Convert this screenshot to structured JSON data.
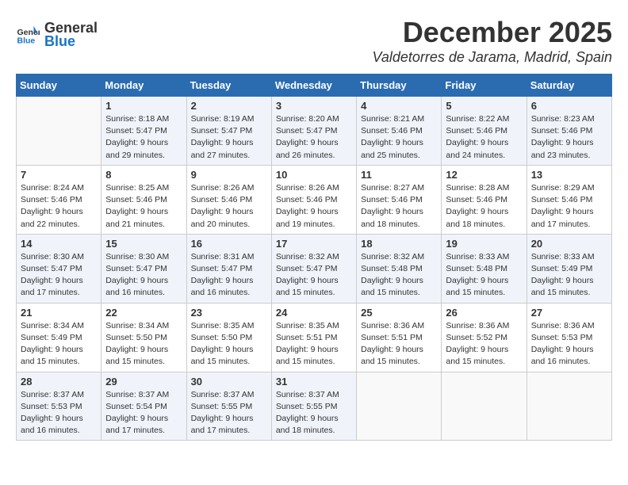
{
  "header": {
    "logo_line1": "General",
    "logo_line2": "Blue",
    "month": "December 2025",
    "location": "Valdetorres de Jarama, Madrid, Spain"
  },
  "weekdays": [
    "Sunday",
    "Monday",
    "Tuesday",
    "Wednesday",
    "Thursday",
    "Friday",
    "Saturday"
  ],
  "weeks": [
    [
      {
        "day": "",
        "info": ""
      },
      {
        "day": "1",
        "info": "Sunrise: 8:18 AM\nSunset: 5:47 PM\nDaylight: 9 hours\nand 29 minutes."
      },
      {
        "day": "2",
        "info": "Sunrise: 8:19 AM\nSunset: 5:47 PM\nDaylight: 9 hours\nand 27 minutes."
      },
      {
        "day": "3",
        "info": "Sunrise: 8:20 AM\nSunset: 5:47 PM\nDaylight: 9 hours\nand 26 minutes."
      },
      {
        "day": "4",
        "info": "Sunrise: 8:21 AM\nSunset: 5:46 PM\nDaylight: 9 hours\nand 25 minutes."
      },
      {
        "day": "5",
        "info": "Sunrise: 8:22 AM\nSunset: 5:46 PM\nDaylight: 9 hours\nand 24 minutes."
      },
      {
        "day": "6",
        "info": "Sunrise: 8:23 AM\nSunset: 5:46 PM\nDaylight: 9 hours\nand 23 minutes."
      }
    ],
    [
      {
        "day": "7",
        "info": "Sunrise: 8:24 AM\nSunset: 5:46 PM\nDaylight: 9 hours\nand 22 minutes."
      },
      {
        "day": "8",
        "info": "Sunrise: 8:25 AM\nSunset: 5:46 PM\nDaylight: 9 hours\nand 21 minutes."
      },
      {
        "day": "9",
        "info": "Sunrise: 8:26 AM\nSunset: 5:46 PM\nDaylight: 9 hours\nand 20 minutes."
      },
      {
        "day": "10",
        "info": "Sunrise: 8:26 AM\nSunset: 5:46 PM\nDaylight: 9 hours\nand 19 minutes."
      },
      {
        "day": "11",
        "info": "Sunrise: 8:27 AM\nSunset: 5:46 PM\nDaylight: 9 hours\nand 18 minutes."
      },
      {
        "day": "12",
        "info": "Sunrise: 8:28 AM\nSunset: 5:46 PM\nDaylight: 9 hours\nand 18 minutes."
      },
      {
        "day": "13",
        "info": "Sunrise: 8:29 AM\nSunset: 5:46 PM\nDaylight: 9 hours\nand 17 minutes."
      }
    ],
    [
      {
        "day": "14",
        "info": "Sunrise: 8:30 AM\nSunset: 5:47 PM\nDaylight: 9 hours\nand 17 minutes."
      },
      {
        "day": "15",
        "info": "Sunrise: 8:30 AM\nSunset: 5:47 PM\nDaylight: 9 hours\nand 16 minutes."
      },
      {
        "day": "16",
        "info": "Sunrise: 8:31 AM\nSunset: 5:47 PM\nDaylight: 9 hours\nand 16 minutes."
      },
      {
        "day": "17",
        "info": "Sunrise: 8:32 AM\nSunset: 5:47 PM\nDaylight: 9 hours\nand 15 minutes."
      },
      {
        "day": "18",
        "info": "Sunrise: 8:32 AM\nSunset: 5:48 PM\nDaylight: 9 hours\nand 15 minutes."
      },
      {
        "day": "19",
        "info": "Sunrise: 8:33 AM\nSunset: 5:48 PM\nDaylight: 9 hours\nand 15 minutes."
      },
      {
        "day": "20",
        "info": "Sunrise: 8:33 AM\nSunset: 5:49 PM\nDaylight: 9 hours\nand 15 minutes."
      }
    ],
    [
      {
        "day": "21",
        "info": "Sunrise: 8:34 AM\nSunset: 5:49 PM\nDaylight: 9 hours\nand 15 minutes."
      },
      {
        "day": "22",
        "info": "Sunrise: 8:34 AM\nSunset: 5:50 PM\nDaylight: 9 hours\nand 15 minutes."
      },
      {
        "day": "23",
        "info": "Sunrise: 8:35 AM\nSunset: 5:50 PM\nDaylight: 9 hours\nand 15 minutes."
      },
      {
        "day": "24",
        "info": "Sunrise: 8:35 AM\nSunset: 5:51 PM\nDaylight: 9 hours\nand 15 minutes."
      },
      {
        "day": "25",
        "info": "Sunrise: 8:36 AM\nSunset: 5:51 PM\nDaylight: 9 hours\nand 15 minutes."
      },
      {
        "day": "26",
        "info": "Sunrise: 8:36 AM\nSunset: 5:52 PM\nDaylight: 9 hours\nand 15 minutes."
      },
      {
        "day": "27",
        "info": "Sunrise: 8:36 AM\nSunset: 5:53 PM\nDaylight: 9 hours\nand 16 minutes."
      }
    ],
    [
      {
        "day": "28",
        "info": "Sunrise: 8:37 AM\nSunset: 5:53 PM\nDaylight: 9 hours\nand 16 minutes."
      },
      {
        "day": "29",
        "info": "Sunrise: 8:37 AM\nSunset: 5:54 PM\nDaylight: 9 hours\nand 17 minutes."
      },
      {
        "day": "30",
        "info": "Sunrise: 8:37 AM\nSunset: 5:55 PM\nDaylight: 9 hours\nand 17 minutes."
      },
      {
        "day": "31",
        "info": "Sunrise: 8:37 AM\nSunset: 5:55 PM\nDaylight: 9 hours\nand 18 minutes."
      },
      {
        "day": "",
        "info": ""
      },
      {
        "day": "",
        "info": ""
      },
      {
        "day": "",
        "info": ""
      }
    ]
  ]
}
